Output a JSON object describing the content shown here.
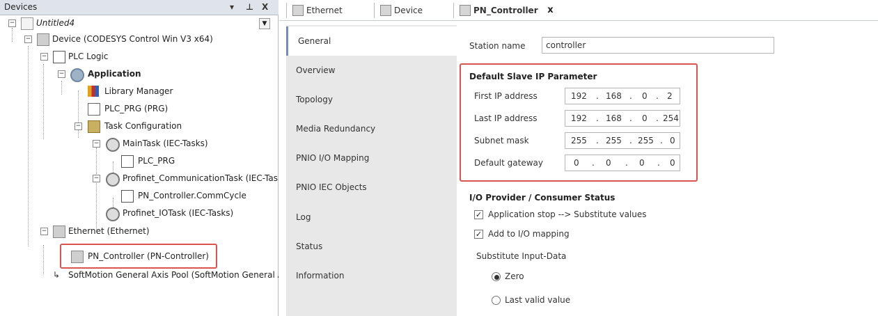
{
  "devices_panel": {
    "title": "Devices",
    "controls": {
      "dropdown": "▾",
      "pin": "⊥",
      "close": "X"
    },
    "tree": [
      {
        "label": "Untitled4",
        "icon": "project-icon"
      },
      {
        "label": "Device (CODESYS Control Win V3 x64)",
        "icon": "device-icon"
      },
      {
        "label": "PLC Logic",
        "icon": "plc-logic-icon"
      },
      {
        "label": "Application",
        "icon": "application-gear-icon"
      },
      {
        "label": "Library Manager",
        "icon": "library-icon"
      },
      {
        "label": "PLC_PRG (PRG)",
        "icon": "program-icon"
      },
      {
        "label": "Task Configuration",
        "icon": "task-config-icon"
      },
      {
        "label": "MainTask (IEC-Tasks)",
        "icon": "task-icon"
      },
      {
        "label": "PLC_PRG",
        "icon": "call-icon"
      },
      {
        "label": "Profinet_CommunicationTask (IEC-Tas",
        "icon": "task-icon"
      },
      {
        "label": "PN_Controller.CommCycle",
        "icon": "call-icon"
      },
      {
        "label": "Profinet_IOTask (IEC-Tasks)",
        "icon": "task-icon"
      },
      {
        "label": "Ethernet (Ethernet)",
        "icon": "device-icon"
      },
      {
        "label": "PN_Controller (PN-Controller)",
        "icon": "device-icon"
      },
      {
        "label": "SoftMotion General Axis Pool (SoftMotion General A",
        "icon": "axis-pool-icon"
      }
    ]
  },
  "editor": {
    "tabs": [
      {
        "label": "Ethernet"
      },
      {
        "label": "Device"
      },
      {
        "label": "PN_Controller",
        "active": true
      }
    ],
    "tab_close": "x",
    "side_tabs": [
      "General",
      "Overview",
      "Topology",
      "Media Redundancy",
      "PNIO I/O Mapping",
      "PNIO IEC Objects",
      "Log",
      "Status",
      "Information"
    ],
    "station_name_label": "Station name",
    "station_name_value": "controller",
    "default_slave_ip": {
      "title": "Default Slave IP Parameter",
      "rows": [
        {
          "label": "First IP address",
          "octets": [
            "192",
            "168",
            "0",
            "2"
          ]
        },
        {
          "label": "Last IP address",
          "octets": [
            "192",
            "168",
            "0",
            "254"
          ]
        },
        {
          "label": "Subnet mask",
          "octets": [
            "255",
            "255",
            "255",
            "0"
          ]
        },
        {
          "label": "Default gateway",
          "octets": [
            "0",
            "0",
            "0",
            "0"
          ]
        }
      ]
    },
    "io_status": {
      "title": "I/O Provider / Consumer Status",
      "checkboxes": [
        {
          "label": "Application stop --> Substitute values",
          "checked": true
        },
        {
          "label": "Add to I/O mapping",
          "checked": true
        }
      ],
      "substitute_label": "Substitute Input-Data",
      "radios": [
        {
          "label": "Zero",
          "selected": true
        },
        {
          "label": "Last valid value",
          "selected": false
        }
      ]
    }
  },
  "colors": {
    "highlight_red": "#d9534f",
    "panel_header": "#dfe4ea",
    "side_tab_bg": "#e8e8e8"
  }
}
